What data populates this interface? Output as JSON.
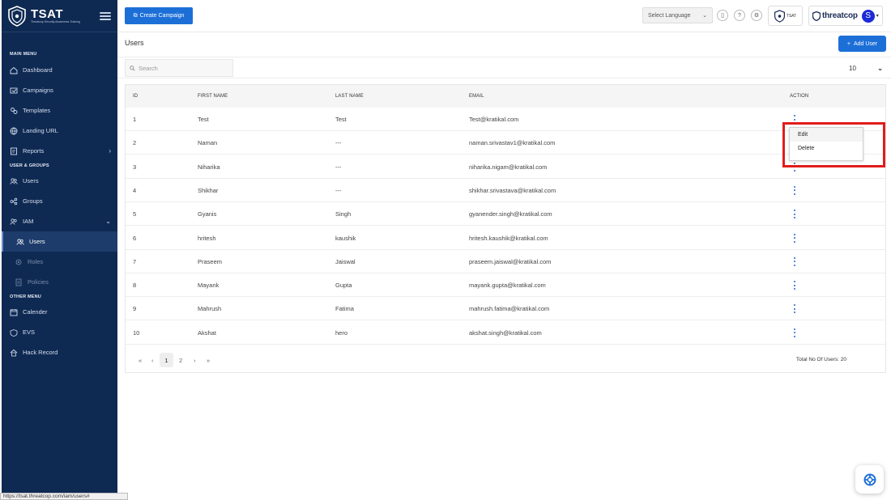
{
  "sidebar": {
    "brand": {
      "name": "TSAT",
      "tagline": "Threatcop Security Awareness Training"
    },
    "sections": {
      "main_menu": "MAIN MENU",
      "users_groups": "USER & GROUPS",
      "other_menu": "OTHER MENU"
    },
    "items": {
      "dashboard": "Dashboard",
      "campaigns": "Campaigns",
      "templates": "Templates",
      "landing_url": "Landing URL",
      "reports": "Reports",
      "users": "Users",
      "groups": "Groups",
      "iam": "IAM",
      "iam_users": "Users",
      "iam_roles": "Roles",
      "iam_policies": "Policies",
      "calender": "Calender",
      "evs": "EVS",
      "hack_record": "Hack Record"
    }
  },
  "status_url": "https://tsat.threatcop.com/iam/users#",
  "header": {
    "create_campaign": "Create Campaign",
    "language": "Select Language",
    "tsat_badge": "TSAT",
    "threatcop": "threatcop",
    "avatar_initial": "S"
  },
  "page": {
    "title": "Users",
    "add_user": "Add User",
    "search_placeholder": "Search",
    "page_size": "10"
  },
  "table": {
    "headers": [
      "ID",
      "FIRST NAME",
      "LAST NAME",
      "EMAIL",
      "ACTION"
    ],
    "rows": [
      {
        "id": "1",
        "first": "Test",
        "last": "Test",
        "email": "Test@kratikal.com"
      },
      {
        "id": "2",
        "first": "Naman",
        "last": "---",
        "email": "naman.srivastav1@kratikal.com"
      },
      {
        "id": "3",
        "first": "Niharika",
        "last": "---",
        "email": "niharika.nigam@kratikal.com"
      },
      {
        "id": "4",
        "first": "Shikhar",
        "last": "---",
        "email": "shikhar.srivastava@kratikal.com"
      },
      {
        "id": "5",
        "first": "Gyanis",
        "last": "Singh",
        "email": "gyanender.singh@kratikal.com"
      },
      {
        "id": "6",
        "first": "hritesh",
        "last": "kaushik",
        "email": "hritesh.kaushik@kratikal.com"
      },
      {
        "id": "7",
        "first": "Praseem",
        "last": "Jaiswal",
        "email": "praseem.jaiswal@kratikal.com"
      },
      {
        "id": "8",
        "first": "Mayank",
        "last": "Gupta",
        "email": "mayank.gupta@kratikal.com"
      },
      {
        "id": "9",
        "first": "Mahrush",
        "last": "Fatima",
        "email": "mahrush.fatima@kratikal.com"
      },
      {
        "id": "10",
        "first": "Akshat",
        "last": "hero",
        "email": "akshat.singh@kratikal.com"
      }
    ]
  },
  "pagination": {
    "first": "«",
    "prev": "‹",
    "pages": [
      "1",
      "2"
    ],
    "current": "1",
    "next": "›",
    "last": "»",
    "total": "Total No Of Users: 20"
  },
  "action_menu": {
    "edit": "Edit",
    "delete": "Delete"
  },
  "colors": {
    "sidebar": "#0f2a52",
    "primary": "#1d6fd8",
    "highlight": "#e21b1b"
  }
}
